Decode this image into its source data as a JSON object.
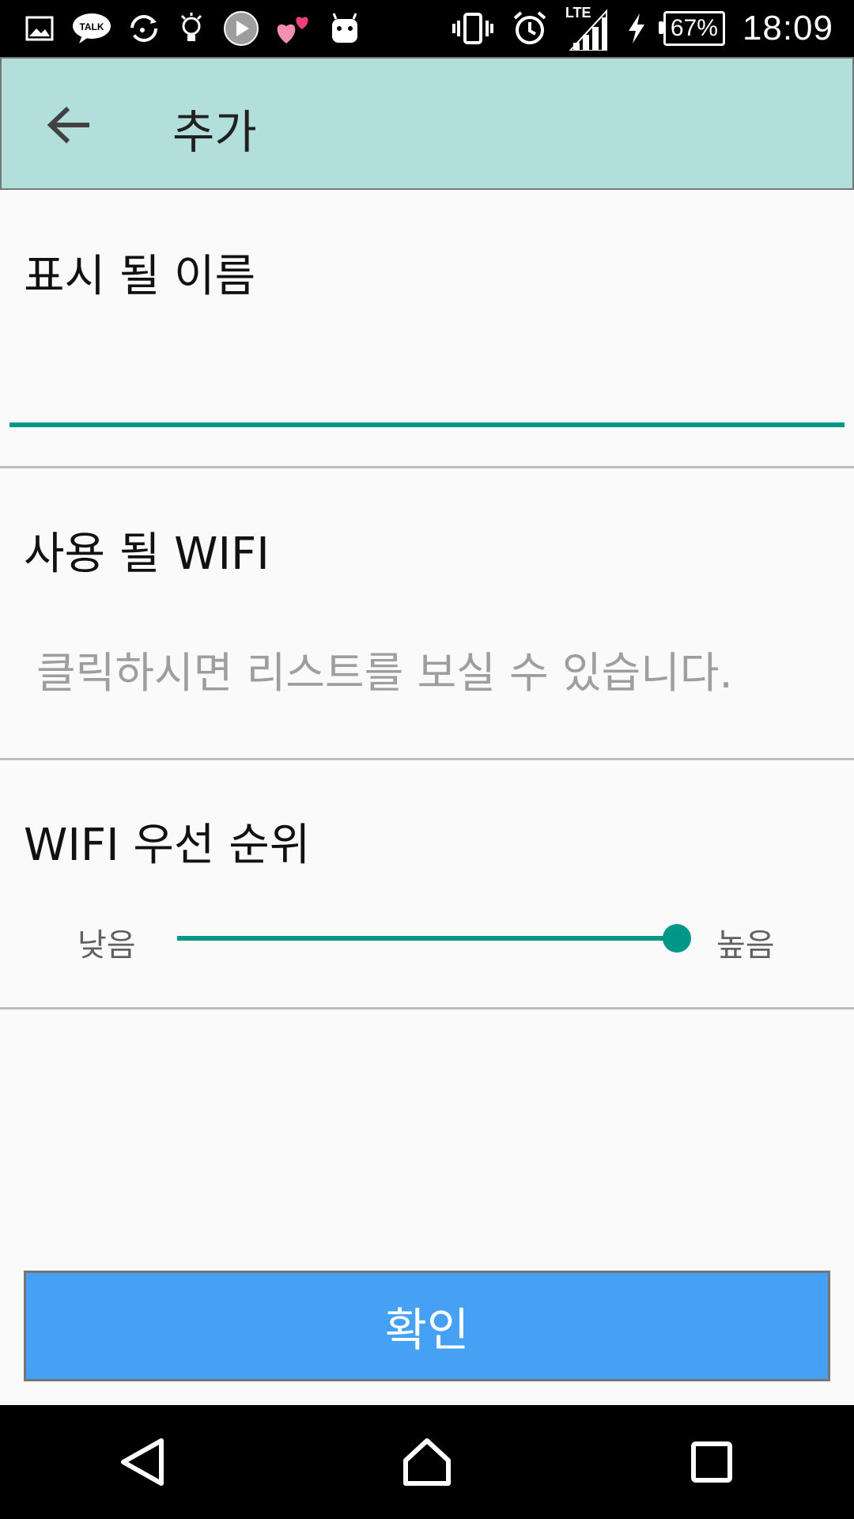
{
  "status_bar": {
    "left_icons": [
      "gallery-icon",
      "kakaotalk-icon",
      "sync-icon",
      "lightbulb-icon",
      "play-icon",
      "hearts-icon",
      "android-icon"
    ],
    "right_icons": [
      "vibrate-icon",
      "alarm-icon",
      "lte-signal-icon",
      "charging-icon"
    ],
    "network_label": "LTE",
    "battery": "67%",
    "time": "18:09"
  },
  "app_bar": {
    "back_icon": "arrow-back-icon",
    "title": "추가",
    "background": "#b2dfdb"
  },
  "form": {
    "name_label": "표시 될 이름",
    "name_value": "",
    "wifi_label": "사용 될 WIFI",
    "wifi_placeholder": "클릭하시면 리스트를 보실 수 있습니다.",
    "priority_label": "WIFI 우선 순위",
    "priority_low": "낮음",
    "priority_high": "높음",
    "priority_value": 1.0,
    "accent": "#009688"
  },
  "confirm_button": {
    "label": "확인",
    "background": "#46a1f5"
  },
  "nav_bar": {
    "icons": [
      "nav-back-icon",
      "nav-home-icon",
      "nav-recents-icon"
    ]
  }
}
